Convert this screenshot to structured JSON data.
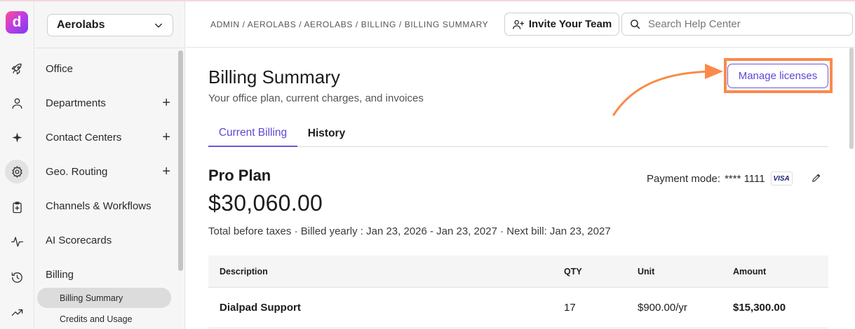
{
  "org_selector": {
    "value": "Aerolabs"
  },
  "sidebar": {
    "items": [
      {
        "label": "Office",
        "expandable": false
      },
      {
        "label": "Departments",
        "expandable": true
      },
      {
        "label": "Contact Centers",
        "expandable": true
      },
      {
        "label": "Geo. Routing",
        "expandable": true
      },
      {
        "label": "Channels & Workflows",
        "expandable": false
      },
      {
        "label": "AI Scorecards",
        "expandable": false
      },
      {
        "label": "Billing",
        "expandable": false
      }
    ],
    "sub_items": [
      {
        "label": "Billing Summary",
        "active": true
      },
      {
        "label": "Credits and Usage",
        "active": false
      }
    ],
    "plus_glyph": "+"
  },
  "rail": {
    "logo_letter": "d",
    "icons": [
      "rocket-icon",
      "user-icon",
      "sparkle-icon",
      "gear-icon",
      "clipboard-icon",
      "activity-icon",
      "history-icon",
      "trending-icon"
    ],
    "active_icon": "gear-icon"
  },
  "header": {
    "breadcrumb": "ADMIN / AEROLABS / AEROLABS / BILLING / BILLING SUMMARY",
    "invite_label": "Invite Your Team",
    "search_placeholder": "Search Help Center"
  },
  "page": {
    "title": "Billing Summary",
    "subtitle": "Your office plan, current charges, and invoices",
    "manage_label": "Manage licenses",
    "tabs": [
      {
        "label": "Current Billing",
        "active": true
      },
      {
        "label": "History",
        "active": false
      }
    ]
  },
  "plan": {
    "name": "Pro Plan",
    "price": "$30,060.00",
    "meta": "Total before taxes  ·  Billed yearly : Jan 23, 2026 - Jan 23, 2027  ·  Next bill: Jan 23, 2027",
    "payment_label": "Payment mode:",
    "card_mask": "**** 1111",
    "card_brand": "VISA"
  },
  "table": {
    "headers": [
      "Description",
      "QTY",
      "Unit",
      "Amount"
    ],
    "rows": [
      [
        "Dialpad Support",
        "17",
        "$900.00/yr",
        "$15,300.00"
      ]
    ]
  },
  "colors": {
    "accent": "#6146d6",
    "highlight": "#fb8a4a",
    "sidebar_bg": "#f6f6f6"
  }
}
